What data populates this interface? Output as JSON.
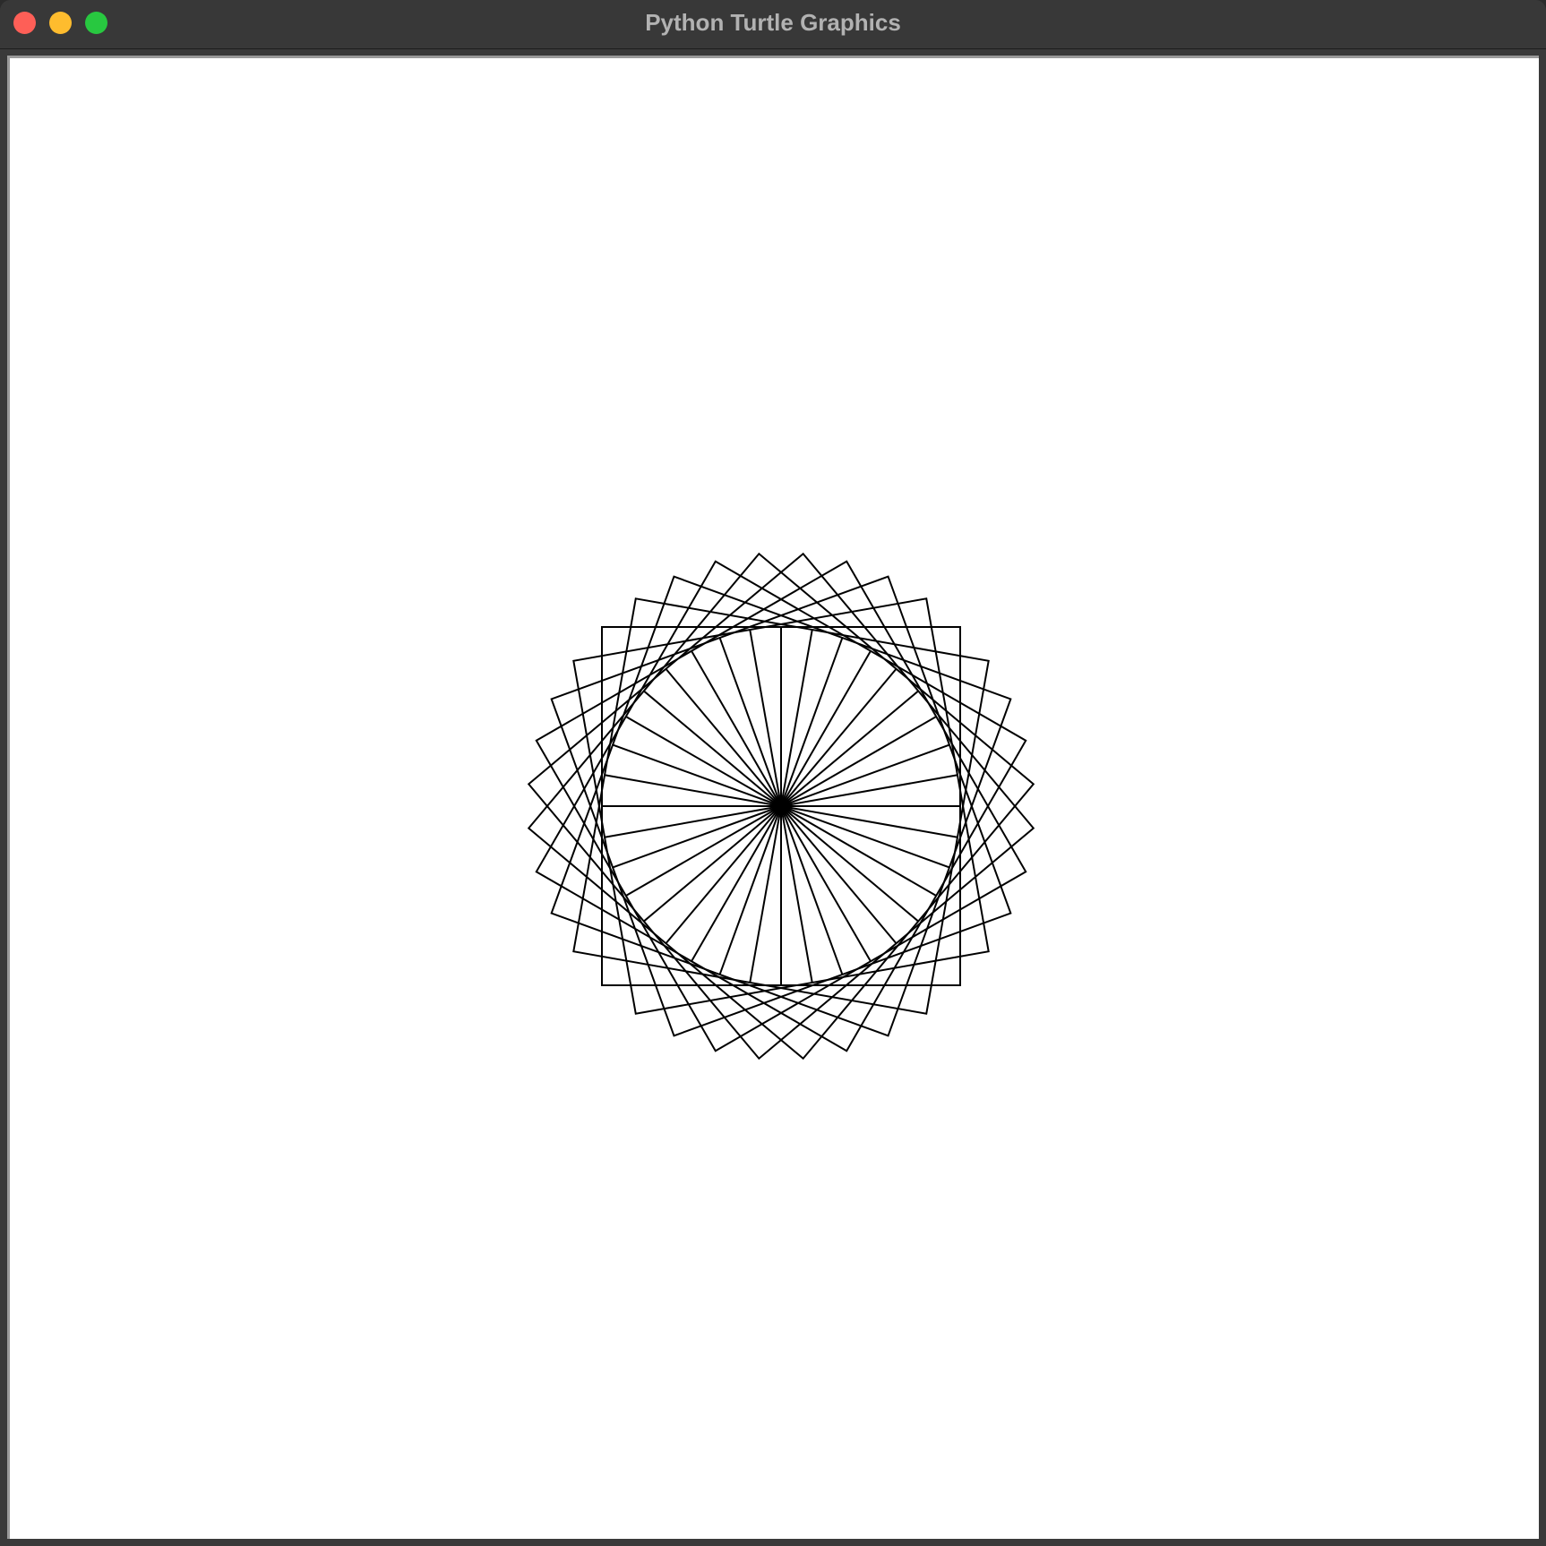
{
  "window": {
    "title": "Python Turtle Graphics"
  },
  "colors": {
    "close": "#fe5f57",
    "minimize": "#febc2e",
    "zoom": "#28c840",
    "titlebar": "#383838",
    "title_text": "#b2b2b2",
    "canvas_bg": "#ffffff",
    "pen": "#000000"
  },
  "drawing": {
    "square_count": 9,
    "square_rotation_step_deg": 10,
    "ray_count": 36,
    "ray_angle_step_deg": 10
  }
}
